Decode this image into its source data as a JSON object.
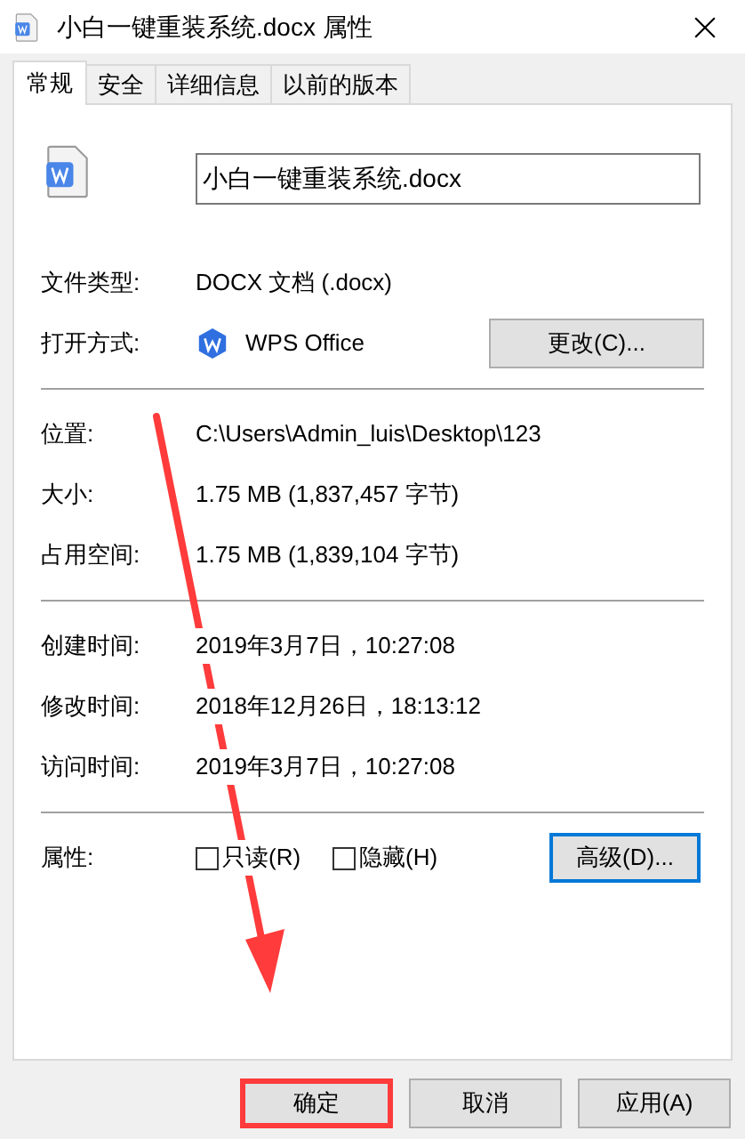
{
  "window": {
    "title": "小白一键重装系统.docx 属性"
  },
  "tabs": [
    {
      "label": "常规",
      "selected": true
    },
    {
      "label": "安全",
      "selected": false
    },
    {
      "label": "详细信息",
      "selected": false
    },
    {
      "label": "以前的版本",
      "selected": false
    }
  ],
  "file_name": {
    "value": "小白一键重装系统.docx"
  },
  "sections": [
    [
      {
        "label": "文件类型:",
        "value": "DOCX 文档 (.docx)",
        "kind": "text"
      },
      {
        "label": "打开方式:",
        "value": "WPS Office",
        "kind": "app",
        "button": "更改(C)..."
      }
    ],
    [
      {
        "label": "位置:",
        "value": "C:\\Users\\Admin_luis\\Desktop\\123",
        "kind": "text"
      },
      {
        "label": "大小:",
        "value": "1.75 MB (1,837,457 字节)",
        "kind": "text"
      },
      {
        "label": "占用空间:",
        "value": "1.75 MB (1,839,104 字节)",
        "kind": "text"
      }
    ],
    [
      {
        "label": "创建时间:",
        "value": "2019年3月7日，10:27:08",
        "kind": "text"
      },
      {
        "label": "修改时间:",
        "value": "2018年12月26日，18:13:12",
        "kind": "text"
      },
      {
        "label": "访问时间:",
        "value": "2019年3月7日，10:27:08",
        "kind": "text"
      }
    ]
  ],
  "attributes": {
    "label": "属性:",
    "checkboxes": [
      {
        "label": "只读(R)",
        "checked": false
      },
      {
        "label": "隐藏(H)",
        "checked": false
      }
    ],
    "button": {
      "label": "高级(D)...",
      "focused": true
    }
  },
  "buttons": [
    {
      "label": "确定",
      "highlighted": true
    },
    {
      "label": "取消",
      "highlighted": false
    },
    {
      "label": "应用(A)",
      "highlighted": false
    }
  ]
}
